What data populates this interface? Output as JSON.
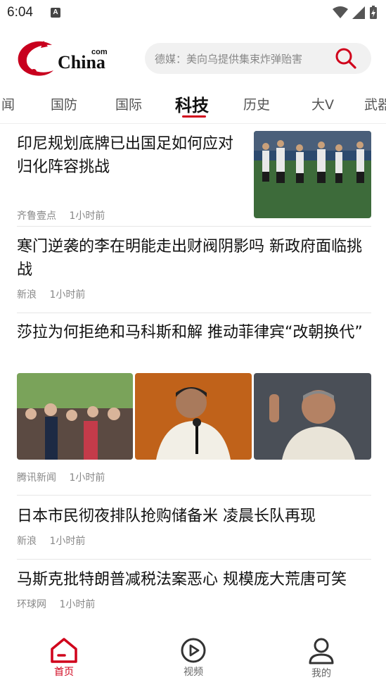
{
  "status": {
    "time": "6:04",
    "notif_badge": "A"
  },
  "header": {
    "logo_text": "China",
    "logo_sup": "com",
    "search_placeholder": "德媒：美向乌提供集束炸弹贻害"
  },
  "tabs": [
    {
      "label": "闻"
    },
    {
      "label": "国防"
    },
    {
      "label": "国际"
    },
    {
      "label": "科技",
      "active": true
    },
    {
      "label": "历史"
    },
    {
      "label": "大V"
    },
    {
      "label": "武器"
    }
  ],
  "articles": [
    {
      "title": "印尼规划底牌已出国足如何应对 归化阵容挑战",
      "source": "齐鲁壹点",
      "time": "1小时前"
    },
    {
      "title": "寒门逆袭的李在明能走出财阀阴影吗 新政府面临挑战",
      "source": "新浪",
      "time": "1小时前"
    },
    {
      "title": "莎拉为何拒绝和马科斯和解 推动菲律宾“改朝换代”",
      "source": "腾讯新闻",
      "time": "1小时前"
    },
    {
      "title": "日本市民彻夜排队抢购储备米 凌晨长队再现",
      "source": "新浪",
      "time": "1小时前"
    },
    {
      "title": "马斯克批特朗普减税法案恶心 规模庞大荒唐可笑",
      "source": "环球网",
      "time": "1小时前"
    }
  ],
  "bottom_nav": [
    {
      "label": "首页",
      "icon": "home-icon",
      "active": true
    },
    {
      "label": "视频",
      "icon": "video-play-icon"
    },
    {
      "label": "我的",
      "icon": "user-icon"
    }
  ],
  "colors": {
    "accent": "#d0021b",
    "text": "#111111",
    "meta": "#888888",
    "search_bg": "#f1f1f1"
  }
}
